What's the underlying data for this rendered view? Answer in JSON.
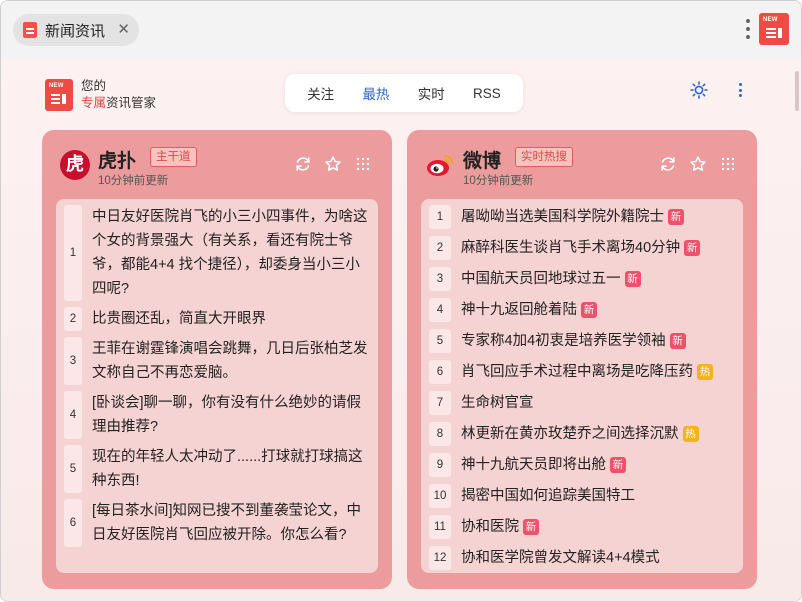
{
  "tab": {
    "title": "新闻资讯"
  },
  "brand": {
    "line1": "您的",
    "accent": "专属",
    "line2_rest": "资讯管家",
    "logo_text": "NEW"
  },
  "nav": {
    "tabs": [
      "关注",
      "最热",
      "实时",
      "RSS"
    ],
    "active": "最热"
  },
  "colors": {
    "accent": "#2a64d6",
    "brand": "#ef4a44",
    "card": "#ec9c9c",
    "badge_new": "#f0506a",
    "badge_hot": "#f6b21b"
  },
  "cards": {
    "hupu": {
      "logo_char": "虎",
      "name": "虎扑",
      "tag": "主干道",
      "updated": "10分钟前更新",
      "items": [
        {
          "n": "1",
          "text": "中日友好医院肖飞的小三小四事件，为啥这个女的背景强大（有关系，看还有院士爷爷，都能4+4 找个捷径），却委身当小三小四呢?"
        },
        {
          "n": "2",
          "text": "比贵圈还乱，简直大开眼界"
        },
        {
          "n": "3",
          "text": "王菲在谢霆锋演唱会跳舞，几日后张柏芝发文称自己不再恋爱脑。"
        },
        {
          "n": "4",
          "text": "[卧谈会]聊一聊，你有没有什么绝妙的请假理由推荐?"
        },
        {
          "n": "5",
          "text": "现在的年轻人太冲动了......打球就打球搞这种东西!"
        },
        {
          "n": "6",
          "text": "[每日茶水间]知网已搜不到董袭莹论文，中日友好医院肖飞回应被开除。你怎么看?"
        }
      ]
    },
    "weibo": {
      "name": "微博",
      "tag": "实时热搜",
      "updated": "10分钟前更新",
      "items": [
        {
          "n": "1",
          "text": "屠呦呦当选美国科学院外籍院士",
          "badge": "新"
        },
        {
          "n": "2",
          "text": "麻醉科医生谈肖飞手术离场40分钟",
          "badge": "新"
        },
        {
          "n": "3",
          "text": "中国航天员回地球过五一",
          "badge": "新"
        },
        {
          "n": "4",
          "text": "神十九返回舱着陆",
          "badge": "新"
        },
        {
          "n": "5",
          "text": "专家称4加4初衷是培养医学领袖",
          "badge": "新"
        },
        {
          "n": "6",
          "text": "肖飞回应手术过程中离场是吃降压药",
          "badge": "热"
        },
        {
          "n": "7",
          "text": "生命树官宣",
          "badge": ""
        },
        {
          "n": "8",
          "text": "林更新在黄亦玫楚乔之间选择沉默",
          "badge": "热"
        },
        {
          "n": "9",
          "text": "神十九航天员即将出舱",
          "badge": "新"
        },
        {
          "n": "10",
          "text": "揭密中国如何追踪美国特工",
          "badge": ""
        },
        {
          "n": "11",
          "text": "协和医院",
          "badge": "新"
        },
        {
          "n": "12",
          "text": "协和医学院曾发文解读4+4模式",
          "badge": ""
        }
      ]
    }
  }
}
